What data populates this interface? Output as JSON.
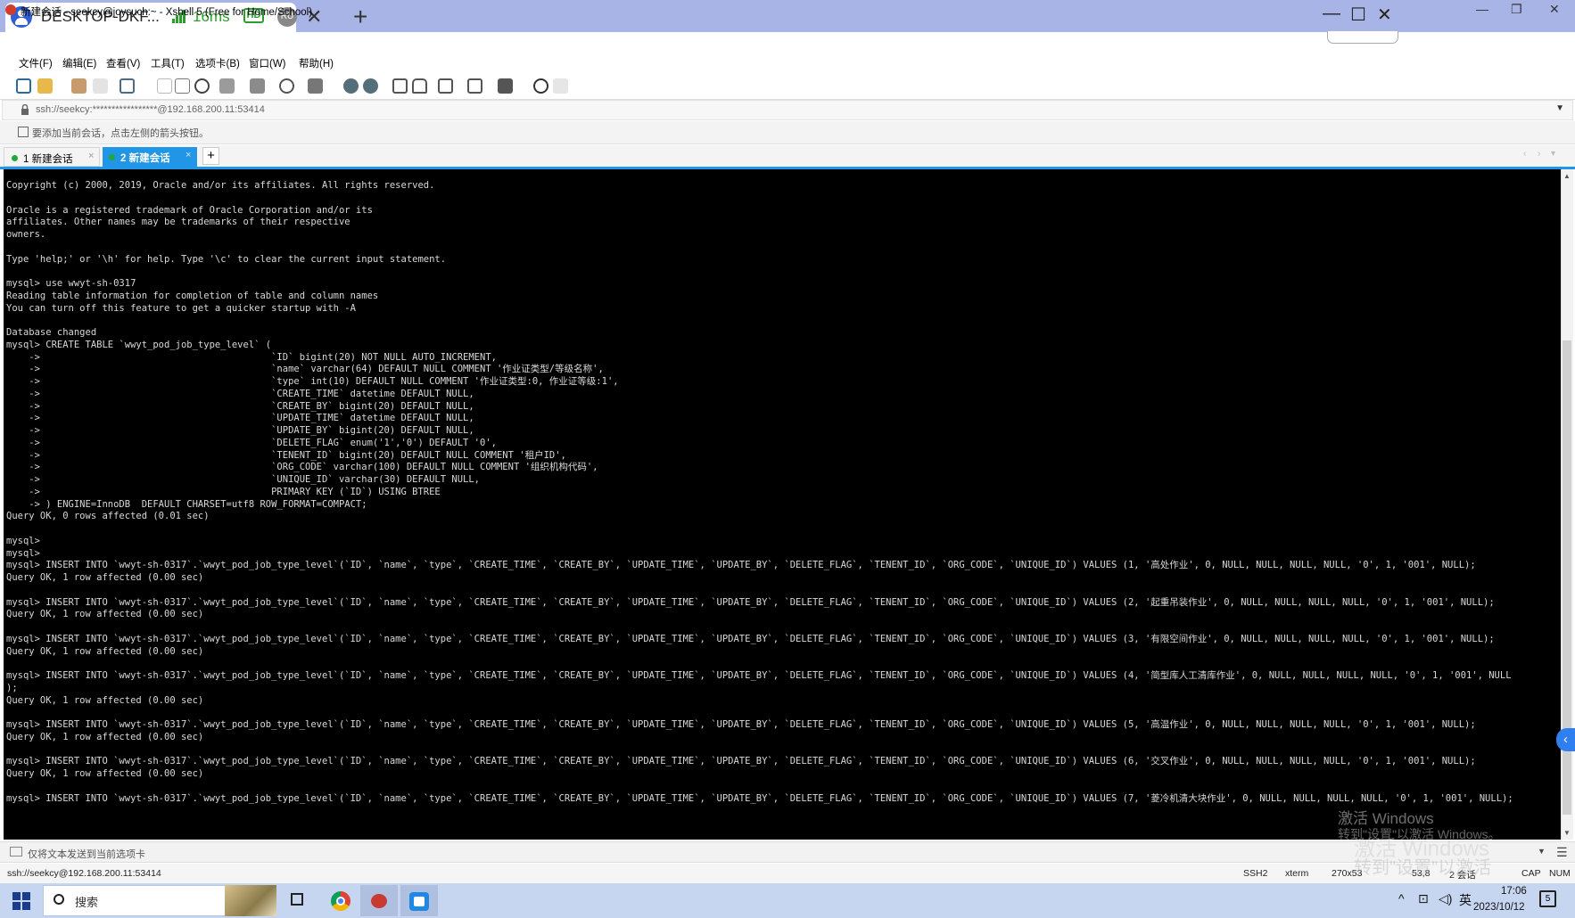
{
  "remote": {
    "host": "DESKTOP-DKF...",
    "ping": "16ms",
    "quality": "HD",
    "lang": "RU"
  },
  "xshell": {
    "title": "新建会话 - seekcy@joysuch:~ - Xshell 5 (Free for Home/School)",
    "menus": [
      "文件(F)",
      "编辑(E)",
      "查看(V)",
      "工具(T)",
      "选项卡(B)",
      "窗口(W)",
      "帮助(H)"
    ],
    "address": "ssh://seekcy:*****************@192.168.200.11:53414",
    "hint": "要添加当前会话，点击左侧的箭头按钮。",
    "tabs": [
      {
        "label": "1 新建会话"
      },
      {
        "label": "2 新建会话"
      }
    ],
    "compose_placeholder": "仅将文本发送到当前选项卡"
  },
  "terminal": {
    "lines": [
      "Copyright (c) 2000, 2019, Oracle and/or its affiliates. All rights reserved.",
      "",
      "Oracle is a registered trademark of Oracle Corporation and/or its",
      "affiliates. Other names may be trademarks of their respective",
      "owners.",
      "",
      "Type 'help;' or '\\h' for help. Type '\\c' to clear the current input statement.",
      "",
      "mysql> use wwyt-sh-0317",
      "Reading table information for completion of table and column names",
      "You can turn off this feature to get a quicker startup with -A",
      "",
      "Database changed",
      "mysql> CREATE TABLE `wwyt_pod_job_type_level` (",
      "    ->                                         `ID` bigint(20) NOT NULL AUTO_INCREMENT,",
      "    ->                                         `name` varchar(64) DEFAULT NULL COMMENT '作业证类型/等级名称',",
      "    ->                                         `type` int(10) DEFAULT NULL COMMENT '作业证类型:0, 作业证等级:1',",
      "    ->                                         `CREATE_TIME` datetime DEFAULT NULL,",
      "    ->                                         `CREATE_BY` bigint(20) DEFAULT NULL,",
      "    ->                                         `UPDATE_TIME` datetime DEFAULT NULL,",
      "    ->                                         `UPDATE_BY` bigint(20) DEFAULT NULL,",
      "    ->                                         `DELETE_FLAG` enum('1','0') DEFAULT '0',",
      "    ->                                         `TENENT_ID` bigint(20) DEFAULT NULL COMMENT '租户ID',",
      "    ->                                         `ORG_CODE` varchar(100) DEFAULT NULL COMMENT '组织机构代码',",
      "    ->                                         `UNIQUE_ID` varchar(30) DEFAULT NULL,",
      "    ->                                         PRIMARY KEY (`ID`) USING BTREE",
      "    -> ) ENGINE=InnoDB  DEFAULT CHARSET=utf8 ROW_FORMAT=COMPACT;",
      "Query OK, 0 rows affected (0.01 sec)",
      "",
      "mysql>",
      "mysql>",
      "mysql> INSERT INTO `wwyt-sh-0317`.`wwyt_pod_job_type_level`(`ID`, `name`, `type`, `CREATE_TIME`, `CREATE_BY`, `UPDATE_TIME`, `UPDATE_BY`, `DELETE_FLAG`, `TENENT_ID`, `ORG_CODE`, `UNIQUE_ID`) VALUES (1, '高处作业', 0, NULL, NULL, NULL, NULL, '0', 1, '001', NULL);",
      "Query OK, 1 row affected (0.00 sec)",
      "",
      "mysql> INSERT INTO `wwyt-sh-0317`.`wwyt_pod_job_type_level`(`ID`, `name`, `type`, `CREATE_TIME`, `CREATE_BY`, `UPDATE_TIME`, `UPDATE_BY`, `DELETE_FLAG`, `TENENT_ID`, `ORG_CODE`, `UNIQUE_ID`) VALUES (2, '起重吊装作业', 0, NULL, NULL, NULL, NULL, '0', 1, '001', NULL);",
      "Query OK, 1 row affected (0.00 sec)",
      "",
      "mysql> INSERT INTO `wwyt-sh-0317`.`wwyt_pod_job_type_level`(`ID`, `name`, `type`, `CREATE_TIME`, `CREATE_BY`, `UPDATE_TIME`, `UPDATE_BY`, `DELETE_FLAG`, `TENENT_ID`, `ORG_CODE`, `UNIQUE_ID`) VALUES (3, '有限空间作业', 0, NULL, NULL, NULL, NULL, '0', 1, '001', NULL);",
      "Query OK, 1 row affected (0.00 sec)",
      "",
      "mysql> INSERT INTO `wwyt-sh-0317`.`wwyt_pod_job_type_level`(`ID`, `name`, `type`, `CREATE_TIME`, `CREATE_BY`, `UPDATE_TIME`, `UPDATE_BY`, `DELETE_FLAG`, `TENENT_ID`, `ORG_CODE`, `UNIQUE_ID`) VALUES (4, '简型库人工清库作业', 0, NULL, NULL, NULL, NULL, '0', 1, '001', NULL",
      ");",
      "Query OK, 1 row affected (0.00 sec)",
      "",
      "mysql> INSERT INTO `wwyt-sh-0317`.`wwyt_pod_job_type_level`(`ID`, `name`, `type`, `CREATE_TIME`, `CREATE_BY`, `UPDATE_TIME`, `UPDATE_BY`, `DELETE_FLAG`, `TENENT_ID`, `ORG_CODE`, `UNIQUE_ID`) VALUES (5, '高温作业', 0, NULL, NULL, NULL, NULL, '0', 1, '001', NULL);",
      "Query OK, 1 row affected (0.00 sec)",
      "",
      "mysql> INSERT INTO `wwyt-sh-0317`.`wwyt_pod_job_type_level`(`ID`, `name`, `type`, `CREATE_TIME`, `CREATE_BY`, `UPDATE_TIME`, `UPDATE_BY`, `DELETE_FLAG`, `TENENT_ID`, `ORG_CODE`, `UNIQUE_ID`) VALUES (6, '交叉作业', 0, NULL, NULL, NULL, NULL, '0', 1, '001', NULL);",
      "Query OK, 1 row affected (0.00 sec)",
      "",
      "mysql> INSERT INTO `wwyt-sh-0317`.`wwyt_pod_job_type_level`(`ID`, `name`, `type`, `CREATE_TIME`, `CREATE_BY`, `UPDATE_TIME`, `UPDATE_BY`, `DELETE_FLAG`, `TENENT_ID`, `ORG_CODE`, `UNIQUE_ID`) VALUES (7, '菱冷机清大块作业', 0, NULL, NULL, NULL, NULL, '0', 1, '001', NULL);"
    ]
  },
  "status": {
    "connection": "ssh://seekcy@192.168.200.11:53414",
    "protocol": "SSH2",
    "term": "xterm",
    "size": "270x53",
    "cursor": "53,8",
    "sessions": "2 会话",
    "caps": "CAP",
    "num": "NUM"
  },
  "watermark": {
    "line1": "激活 Windows",
    "line2": "转到\"设置\"以激活 Windows。"
  },
  "taskbar": {
    "search": "搜索",
    "ime": "英",
    "time": "17:06",
    "date": "2023/10/12",
    "notifications": "5"
  },
  "colors": {
    "accent": "#2196e6",
    "terminal_bg": "#000000",
    "terminal_fg": "#d8d8d8",
    "remote_bar": "#a9b4e6",
    "taskbar": "#c6d6f0"
  }
}
